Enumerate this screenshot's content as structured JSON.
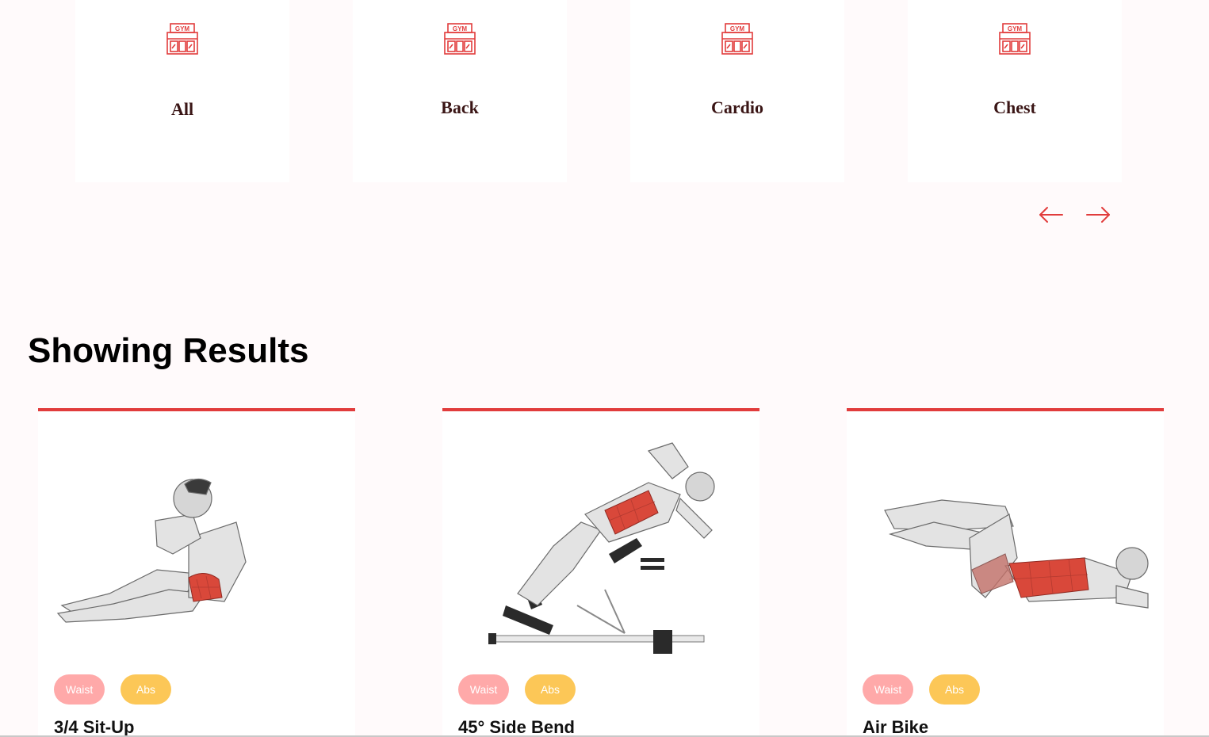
{
  "categories": [
    {
      "label": "All",
      "icon": "gym-icon"
    },
    {
      "label": "Back",
      "icon": "gym-icon"
    },
    {
      "label": "Cardio",
      "icon": "gym-icon"
    },
    {
      "label": "Chest",
      "icon": "gym-icon"
    }
  ],
  "carousel": {
    "prev_icon": "arrow-left-icon",
    "next_icon": "arrow-right-icon",
    "accent_color": "#e13c3c"
  },
  "results": {
    "title": "Showing Results",
    "exercises": [
      {
        "name": "3/4 Sit-Up",
        "tags": [
          "Waist",
          "Abs"
        ]
      },
      {
        "name": "45° Side Bend",
        "tags": [
          "Waist",
          "Abs"
        ]
      },
      {
        "name": "Air Bike",
        "tags": [
          "Waist",
          "Abs"
        ]
      }
    ]
  },
  "colors": {
    "background": "#fffafb",
    "card": "#ffffff",
    "accent": "#e13c3c",
    "tag_waist": "#ffa9a9",
    "tag_abs": "#fcc757",
    "category_text": "#3a1515"
  }
}
